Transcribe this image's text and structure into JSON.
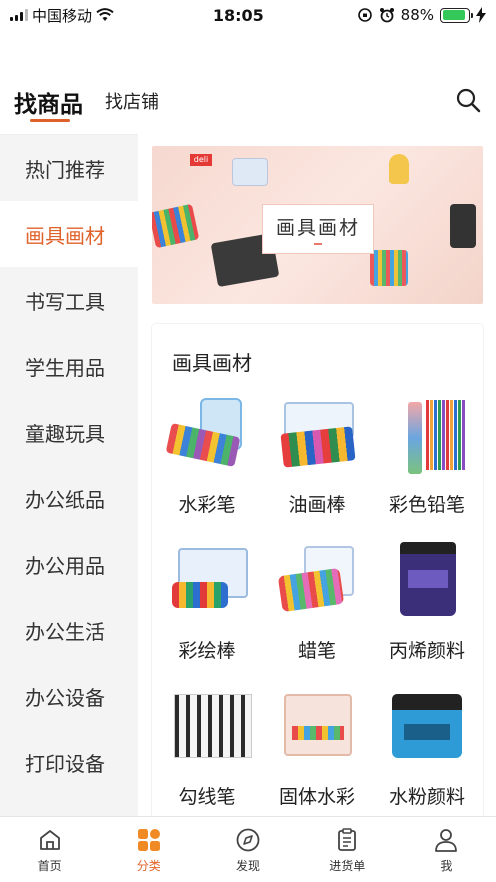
{
  "status_bar": {
    "carrier": "中国移动",
    "time": "18:05",
    "battery": "88%",
    "battery_level": 0.88
  },
  "header": {
    "tab_active": "找商品",
    "tab_other": "找店铺"
  },
  "sidebar": {
    "items": [
      {
        "label": "热门推荐"
      },
      {
        "label": "画具画材"
      },
      {
        "label": "书写工具"
      },
      {
        "label": "学生用品"
      },
      {
        "label": "童趣玩具"
      },
      {
        "label": "办公纸品"
      },
      {
        "label": "办公用品"
      },
      {
        "label": "办公生活"
      },
      {
        "label": "办公设备"
      },
      {
        "label": "打印设备"
      }
    ],
    "active_index": 1
  },
  "banner": {
    "title": "画具画材",
    "logo": "deli"
  },
  "category": {
    "title": "画具画材",
    "items": [
      {
        "label": "水彩笔"
      },
      {
        "label": "油画棒"
      },
      {
        "label": "彩色铅笔"
      },
      {
        "label": "彩绘棒"
      },
      {
        "label": "蜡笔"
      },
      {
        "label": "丙烯颜料"
      },
      {
        "label": "勾线笔"
      },
      {
        "label": "固体水彩"
      },
      {
        "label": "水粉颜料"
      }
    ]
  },
  "bottom_nav": {
    "items": [
      {
        "label": "首页",
        "icon": "home-icon"
      },
      {
        "label": "分类",
        "icon": "category-icon"
      },
      {
        "label": "发现",
        "icon": "compass-icon"
      },
      {
        "label": "进货单",
        "icon": "clipboard-icon"
      },
      {
        "label": "我",
        "icon": "user-icon"
      }
    ],
    "active_index": 1
  },
  "colors": {
    "accent": "#e0622b",
    "battery": "#34c759"
  }
}
